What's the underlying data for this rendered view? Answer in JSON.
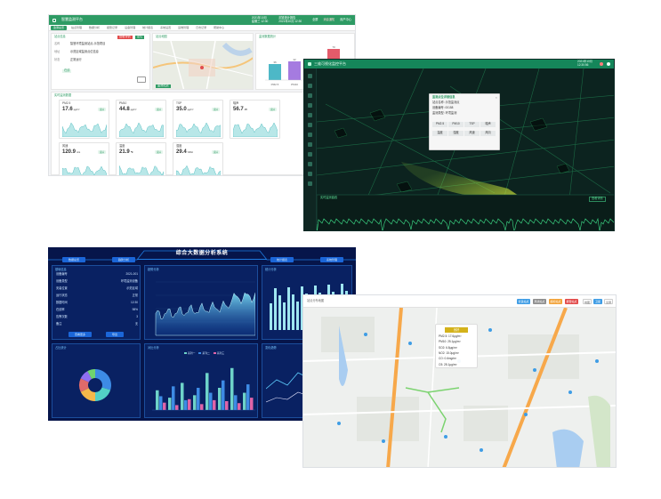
{
  "s1": {
    "title": "智慧监测平台",
    "header_info_left": "2021年10月\n星期三 12:30",
    "header_info_right": "浏览统计报告\n2021年10月 12:30",
    "header_actions": [
      "全屏",
      "消息通知",
      "用户中心"
    ],
    "tabs": [
      "监测总览",
      "站点管理",
      "数据分析",
      "报警记录",
      "设备管理",
      "统计报表",
      "系统设置",
      "运维管理",
      "日志记录",
      "帮助中心"
    ],
    "site_panel": {
      "title": "站点信息",
      "buttons": [
        "查看详情",
        "定位"
      ],
      "rows": [
        {
          "k": "名称",
          "v": "智慧环境监测站点-示范项目"
        },
        {
          "k": "地址",
          "v": "示范区域监测点位信息"
        },
        {
          "k": "状态",
          "v": "正常运行"
        }
      ],
      "status_badge": "在线"
    },
    "map_panel": {
      "title": "站点地图",
      "legend": "监测站点"
    },
    "bar_panel": {
      "title": "监测数据统计",
      "labels": [
        "PM2.5",
        "PM10",
        "SO2",
        "NO2"
      ],
      "values": [
        36,
        42,
        15,
        70
      ],
      "colors": [
        "#4db8c7",
        "#a57be0",
        "#3d8be5",
        "#e35b6a"
      ]
    },
    "cards_title": "实时监测数据",
    "cards": [
      {
        "name": "PM2.5",
        "value": "17.6",
        "unit": "μg/m³",
        "badge": "良好"
      },
      {
        "name": "PM10",
        "value": "44.8",
        "unit": "μg/m³",
        "badge": "良好"
      },
      {
        "name": "TSP",
        "value": "35.0",
        "unit": "μg/m³",
        "badge": "良好"
      },
      {
        "name": "噪声",
        "value": "56.7",
        "unit": "dB",
        "badge": "良好"
      },
      {
        "name": "风速",
        "value": "120.9",
        "unit": "m/s",
        "badge": "良好"
      },
      {
        "name": "温度",
        "value": "21.9",
        "unit": "℃",
        "badge": "良好"
      },
      {
        "name": "湿度",
        "value": "29.4",
        "unit": "%RH",
        "badge": "良好"
      }
    ]
  },
  "s2": {
    "title": "三维可视化监控平台",
    "header_info": "2021年10月\n12:30:56",
    "popup": {
      "title": "监测点位详细信息",
      "lines": [
        "站点名称: 示范监测点",
        "设备编号: 00158",
        "监测类型: 环境监测"
      ],
      "cells": [
        "PM2.5",
        "PM10",
        "TSP",
        "噪声",
        "温度",
        "湿度",
        "风速",
        "风向"
      ]
    },
    "chart_title": "实时监测曲线",
    "chart_btn": "查看详情"
  },
  "s3": {
    "title": "综合大数据分析系统",
    "top_buttons": [
      "数据总览",
      "趋势分析",
      "统计报表",
      "系统管理"
    ],
    "left_panel": {
      "title": "基础信息",
      "rows": [
        {
          "k": "设备编号",
          "v": "2021-001"
        },
        {
          "k": "设备类型",
          "v": "环境监测设备"
        },
        {
          "k": "安装位置",
          "v": "示范区域"
        },
        {
          "k": "运行状态",
          "v": "正常"
        },
        {
          "k": "数据时间",
          "v": "12:30"
        },
        {
          "k": "在线率",
          "v": "98%"
        },
        {
          "k": "告警次数",
          "v": "3"
        },
        {
          "k": "备注",
          "v": "无"
        }
      ],
      "buttons": [
        "查看更多",
        "导出"
      ]
    },
    "area_title": "趋势分析",
    "right_title": "统计分析",
    "donut_title": "占比统计",
    "donut": {
      "values": [
        30,
        20,
        18,
        14,
        10,
        8
      ],
      "colors": [
        "#3d8be5",
        "#52d1c6",
        "#f5b84a",
        "#e06a6a",
        "#8f6ff0",
        "#6fd46f"
      ]
    },
    "bars_title": "对比分析",
    "bars_legend": [
      "系列一",
      "系列二",
      "系列三"
    ],
    "bars": {
      "series": [
        {
          "color": "#6ed3c9",
          "values": [
            40,
            25,
            55,
            30,
            75,
            45,
            85,
            35
          ]
        },
        {
          "color": "#3d8be5",
          "values": [
            28,
            48,
            20,
            45,
            35,
            60,
            30,
            52
          ]
        },
        {
          "color": "#e064a8",
          "values": [
            15,
            10,
            22,
            12,
            20,
            18,
            14,
            25
          ]
        }
      ]
    },
    "line_title": "变化趋势"
  },
  "s4": {
    "title": "站点分布地图",
    "buttons": [
      {
        "label": "优良站点",
        "color": "#3f9de5"
      },
      {
        "label": "离线站点",
        "color": "#8e8e8e"
      },
      {
        "label": "超标站点",
        "color": "#f2a33a"
      },
      {
        "label": "报警站点",
        "color": "#e24b4b"
      },
      {
        "label": "地图",
        "color": "#ffffff"
      },
      {
        "label": "卫星",
        "color": "#3f9de5"
      },
      {
        "label": "全屏",
        "color": "#ffffff"
      }
    ],
    "infobox": {
      "badge": "良好",
      "lines": [
        "PM2.5: 17.6μg/m³",
        "PM10: 25.1μg/m³",
        "SO2: 6.8μg/m³",
        "NO2: 15.0μg/m³",
        "CO: 0.6mg/m³",
        "O3: 28.1μg/m³"
      ]
    }
  }
}
